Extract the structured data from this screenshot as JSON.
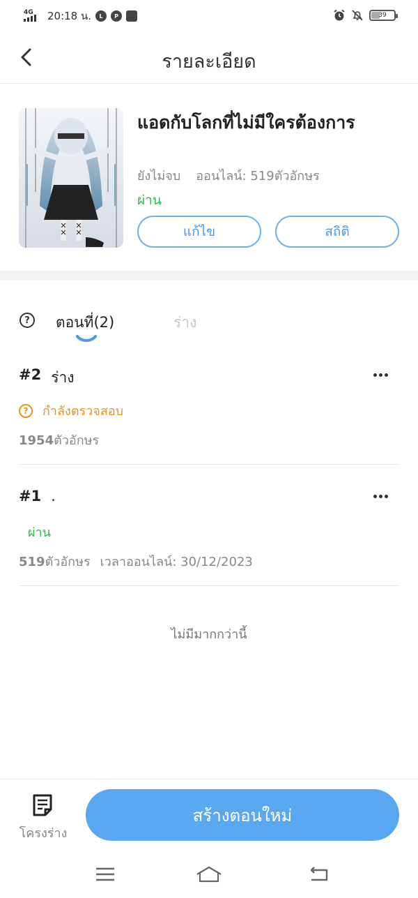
{
  "status_bar": {
    "network": "4G",
    "time": "20:18 น.",
    "battery": "39",
    "battery_level_percent": 39
  },
  "header": {
    "title": "รายละเอียด"
  },
  "book": {
    "title": "แอดกับโลกที่ไม่มีใครต้องการ",
    "progress": "ยังไม่จบ",
    "online": "ออนไลน์: 519ตัวอักษร",
    "status": "ผ่าน",
    "edit_label": "แก้ไข",
    "stats_label": "สถิติ"
  },
  "tabs": {
    "episodes": "ตอนที่(2)",
    "draft": "ร่าง"
  },
  "chapters": [
    {
      "number": "#2",
      "title": "ร่าง",
      "state": "กำลังตรวจสอบ",
      "chars": "1954",
      "chars_unit": "ตัวอักษร",
      "published": ""
    },
    {
      "number": "#1",
      "title": ".",
      "state": "ผ่าน",
      "chars": "519",
      "chars_unit": "ตัวอักษร",
      "published": "เวลาออนไลน์:  30/12/2023"
    }
  ],
  "list_footer": "ไม่มีมากกว่านี้",
  "bottom_bar": {
    "drafts_label": "โครงร่าง",
    "create_label": "สร้างตอนใหม่"
  },
  "colors": {
    "accent": "#5aa8f2",
    "pass": "#2fb84f",
    "pending": "#e8941a"
  }
}
